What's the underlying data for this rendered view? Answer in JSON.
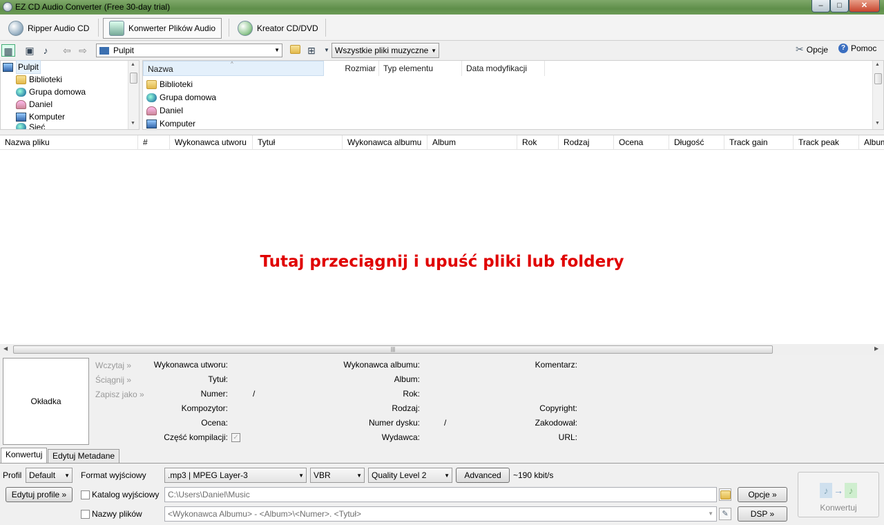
{
  "window": {
    "title": "EZ CD Audio Converter (Free 30-day trial)",
    "min": "‒",
    "max": "□",
    "close": "✕"
  },
  "modes": [
    {
      "label": "Ripper Audio CD"
    },
    {
      "label": "Konwerter Plików Audio"
    },
    {
      "label": "Kreator CD/DVD"
    }
  ],
  "toolbar": {
    "location": "Pulpit",
    "filter": "Wszystkie pliki muzyczne",
    "options_label": "Opcje",
    "help_label": "Pomoc"
  },
  "tree": {
    "items": [
      "Pulpit",
      "Biblioteki",
      "Grupa domowa",
      "Daniel",
      "Komputer",
      "Sieć"
    ]
  },
  "file_columns": [
    "Nazwa",
    "Rozmiar",
    "Typ elementu",
    "Data modyfikacji"
  ],
  "files": [
    "Biblioteki",
    "Grupa domowa",
    "Daniel",
    "Komputer"
  ],
  "track_columns": [
    "Nazwa pliku",
    "#",
    "Wykonawca utworu",
    "Tytuł",
    "Wykonawca albumu",
    "Album",
    "Rok",
    "Rodzaj",
    "Ocena",
    "Długość",
    "Track gain",
    "Track peak",
    "Album"
  ],
  "drop_hint": "Tutaj przeciągnij i upuść pliki lub foldery",
  "metadata": {
    "cover": "Okładka",
    "links": [
      "Wczytaj »",
      "Ściągnij »",
      "Zapisz jako »"
    ],
    "col1": [
      "Wykonawca utworu:",
      "Tytuł:",
      "Numer:",
      "Kompozytor:",
      "Ocena:",
      "Część kompilacji:"
    ],
    "number_sep": "/",
    "col2": [
      "Wykonawca albumu:",
      "Album:",
      "Rok:",
      "Rodzaj:",
      "Numer dysku:",
      "Wydawca:"
    ],
    "disc_sep": "/",
    "col3": [
      "Komentarz:",
      "",
      "",
      "Copyright:",
      "Zakodował:",
      "URL:"
    ]
  },
  "bottom_tabs": [
    "Konwertuj",
    "Edytuj Metadane"
  ],
  "convert_panel": {
    "profile_label": "Profil",
    "profile_value": "Default",
    "edit_profile": "Edytuj profile »",
    "format_label": "Format wyjściowy",
    "format_value": ".mp3 | MPEG Layer-3",
    "mode_value": "VBR",
    "quality_value": "Quality Level 2",
    "advanced": "Advanced",
    "bitrate": "~190 kbit/s",
    "outdir_label": "Katalog wyjściowy",
    "outdir_value": "C:\\Users\\Daniel\\Music",
    "options_btn": "Opcje »",
    "filenames_label": "Nazwy plików",
    "filenames_value": "<Wykonawca Albumu> - <Album>\\<Numer>. <Tytuł>",
    "dsp_btn": "DSP »",
    "convert_btn": "Konwertuj"
  }
}
